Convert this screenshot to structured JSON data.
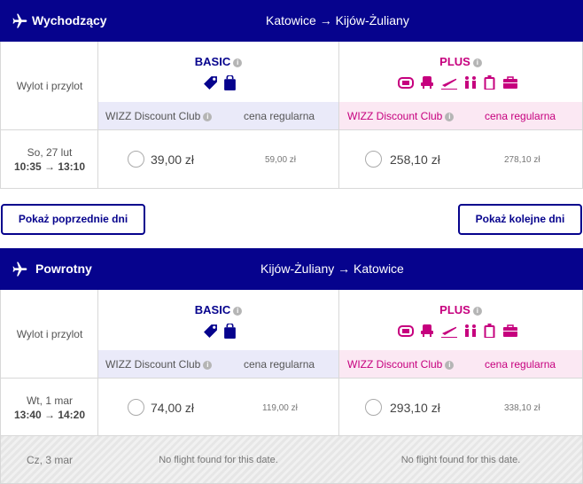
{
  "outbound": {
    "direction_label": "Wychodzący",
    "route": "Katowice → Kijów-Żuliany",
    "column_label": "Wylot i przylot",
    "basic_label": "BASIC",
    "plus_label": "PLUS",
    "club_label": "WIZZ Discount Club",
    "regular_label": "cena regularna",
    "flights": [
      {
        "date": "So, 27 lut",
        "times": "10:35 → 13:10",
        "basic_club_price": "39,00 zł",
        "basic_regular_price": "59,00 zł",
        "plus_club_price": "258,10 zł",
        "plus_regular_price": "278,10 zł"
      }
    ]
  },
  "navigation": {
    "prev_label": "Pokaż poprzednie dni",
    "next_label": "Pokaż kolejne dni"
  },
  "return": {
    "direction_label": "Powrotny",
    "route": "Kijów-Żuliany → Katowice",
    "column_label": "Wylot i przylot",
    "basic_label": "BASIC",
    "plus_label": "PLUS",
    "club_label": "WIZZ Discount Club",
    "regular_label": "cena regularna",
    "flights": [
      {
        "date": "Wt, 1 mar",
        "times": "13:40 → 14:20",
        "basic_club_price": "74,00 zł",
        "basic_regular_price": "119,00 zł",
        "plus_club_price": "293,10 zł",
        "plus_regular_price": "338,10 zł"
      }
    ],
    "no_flight_row": {
      "date": "Cz, 3 mar",
      "basic_text": "No flight found for this date.",
      "plus_text": "No flight found for this date."
    }
  },
  "colors": {
    "header_bg": "#06038d",
    "basic": "#06038d",
    "plus": "#c6007e"
  },
  "icons": {
    "header": "airplane-icon",
    "info": "info-icon",
    "basic": [
      "tag-icon",
      "bag-icon"
    ],
    "plus": [
      "seat-icon",
      "chair-icon",
      "takeoff-icon",
      "people-icon",
      "luggage-icon",
      "suitcase-icon"
    ]
  }
}
